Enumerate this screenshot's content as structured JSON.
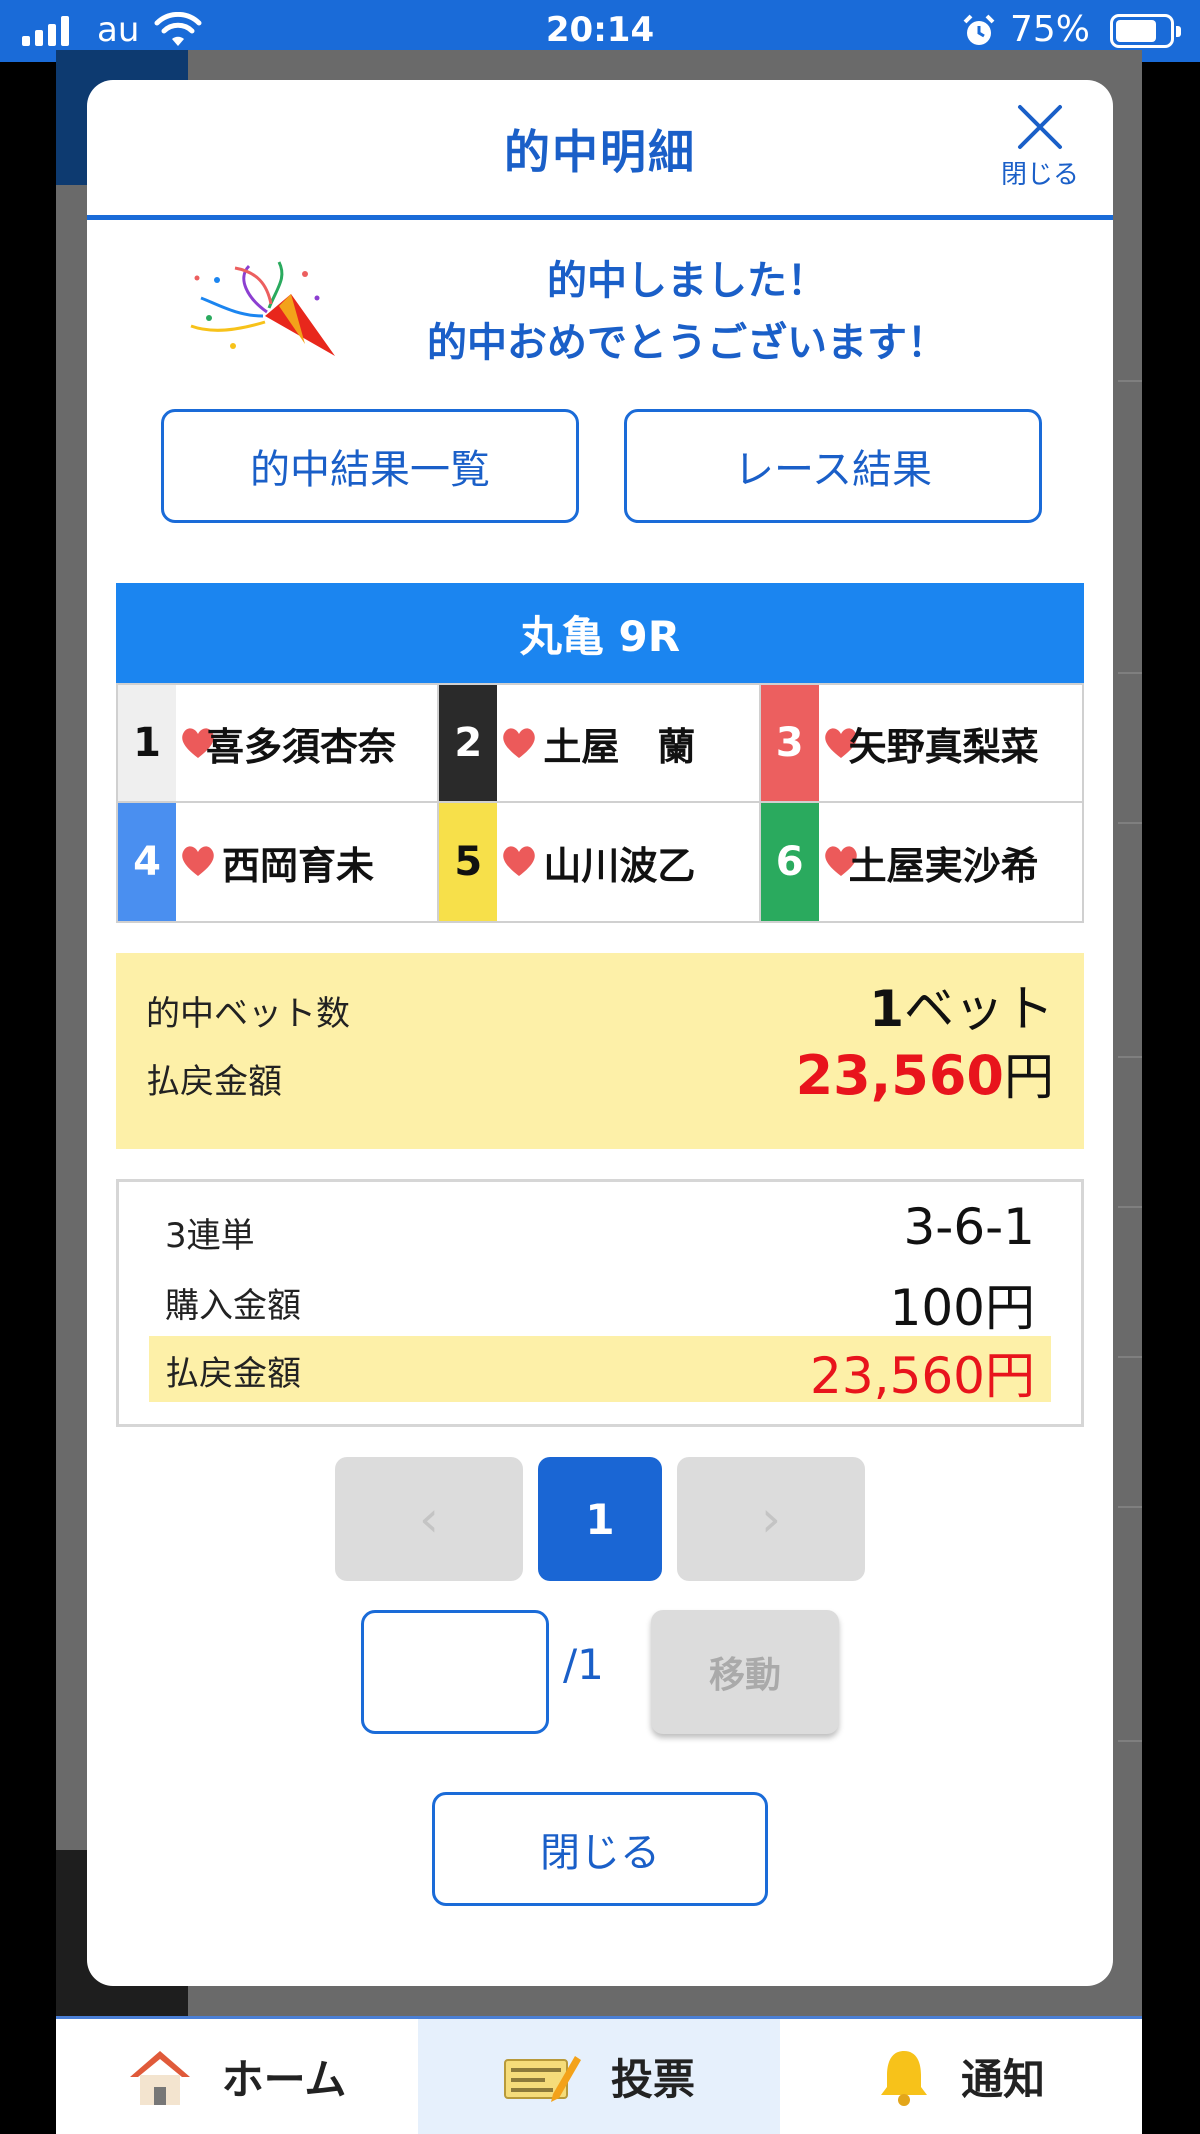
{
  "status_bar": {
    "carrier": "au",
    "time": "20:14",
    "battery": "75%",
    "battery_level": 0.75
  },
  "modal": {
    "title": "的中明細",
    "close_x_label": "閉じる",
    "congrats_line1": "的中しました！",
    "congrats_line2": "的中おめでとうございます！",
    "btn_hit_list": "的中結果一覧",
    "btn_race_result": "レース結果",
    "race_title": "丸亀 9R",
    "racers": [
      {
        "num": "1",
        "name": "喜多須杏奈",
        "color": "#efefef",
        "text_color": "#111"
      },
      {
        "num": "2",
        "name": "土屋　蘭",
        "color": "#2a2a2a",
        "text_color": "#fff"
      },
      {
        "num": "3",
        "name": "矢野真梨菜",
        "color": "#ec5f5f",
        "text_color": "#fff"
      },
      {
        "num": "4",
        "name": "西岡育未",
        "color": "#4a8ff0",
        "text_color": "#fff"
      },
      {
        "num": "5",
        "name": "山川波乙",
        "color": "#f7e04a",
        "text_color": "#111"
      },
      {
        "num": "6",
        "name": "土屋実沙希",
        "color": "#2aaa5e",
        "text_color": "#fff"
      }
    ],
    "summary": {
      "hit_bets_label": "的中ベット数",
      "hit_bets_value": "1",
      "hit_bets_unit": "ベット",
      "payout_label": "払戻金額",
      "payout_value": "23,560",
      "payout_unit": "円"
    },
    "detail": {
      "bet_type": "3連単",
      "combination": "3-6-1",
      "purchase_label": "購入金額",
      "purchase_value": "100円",
      "payout_label": "払戻金額",
      "payout_value": "23,560円"
    },
    "pager": {
      "prev": "‹",
      "current": "1",
      "next": "›",
      "input_value": "",
      "total": "/1",
      "move_label": "移動"
    },
    "close_button": "閉じる"
  },
  "bottom_nav": [
    {
      "label": "ホーム",
      "icon": "home-icon"
    },
    {
      "label": "投票",
      "icon": "ticket-pencil-icon",
      "active": true
    },
    {
      "label": "通知",
      "icon": "bell-icon"
    }
  ],
  "colors": {
    "primary": "#1a6bd8",
    "race_header": "#1b85f0",
    "highlight_bg": "#fdf0a8",
    "payout_red": "#e8141c"
  }
}
